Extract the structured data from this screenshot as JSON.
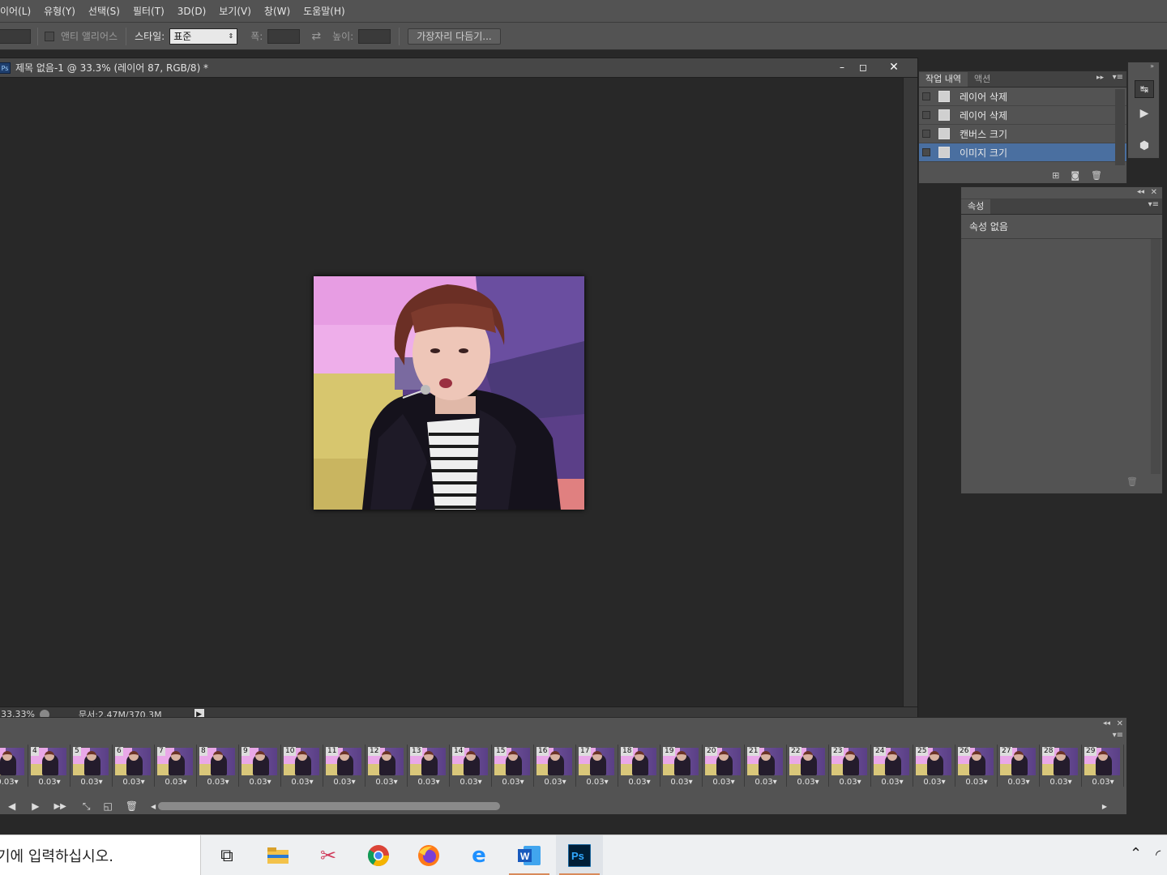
{
  "menu": [
    "이어(L)",
    "유형(Y)",
    "선택(S)",
    "필터(T)",
    "3D(D)",
    "보기(V)",
    "창(W)",
    "도움말(H)"
  ],
  "options": {
    "antialias": "앤티 앨리어스",
    "style_label": "스타일:",
    "style_value": "표준",
    "width_label": "폭:",
    "height_label": "높이:",
    "refine_button": "가장자리 다듬기..."
  },
  "document": {
    "title": "제목 없음-1 @ 33.3% (레이어 87, RGB/8) *",
    "zoom": "33.33%",
    "doc_info": "문서:2.47M/370.3M"
  },
  "history": {
    "tabs": [
      "작업 내역",
      "액션"
    ],
    "items": [
      "레이어 삭제",
      "레이어 삭제",
      "캔버스 크기",
      "이미지 크기"
    ]
  },
  "properties": {
    "tab": "속성",
    "empty": "속성 없음"
  },
  "timeline": {
    "frames": [
      "",
      "4",
      "5",
      "6",
      "7",
      "8",
      "9",
      "10",
      "11",
      "12",
      "13",
      "14",
      "15",
      "16",
      "17",
      "18",
      "19",
      "20",
      "21",
      "22",
      "23",
      "24",
      "25",
      "26",
      "27",
      "28",
      "29"
    ],
    "delay": "0.03"
  },
  "taskbar": {
    "search_placeholder": "기에 입력하십시오."
  },
  "colors": {
    "accent_selected": "#4a6fa0",
    "panel_bg": "#535353",
    "canvas_bg": "#282828"
  }
}
